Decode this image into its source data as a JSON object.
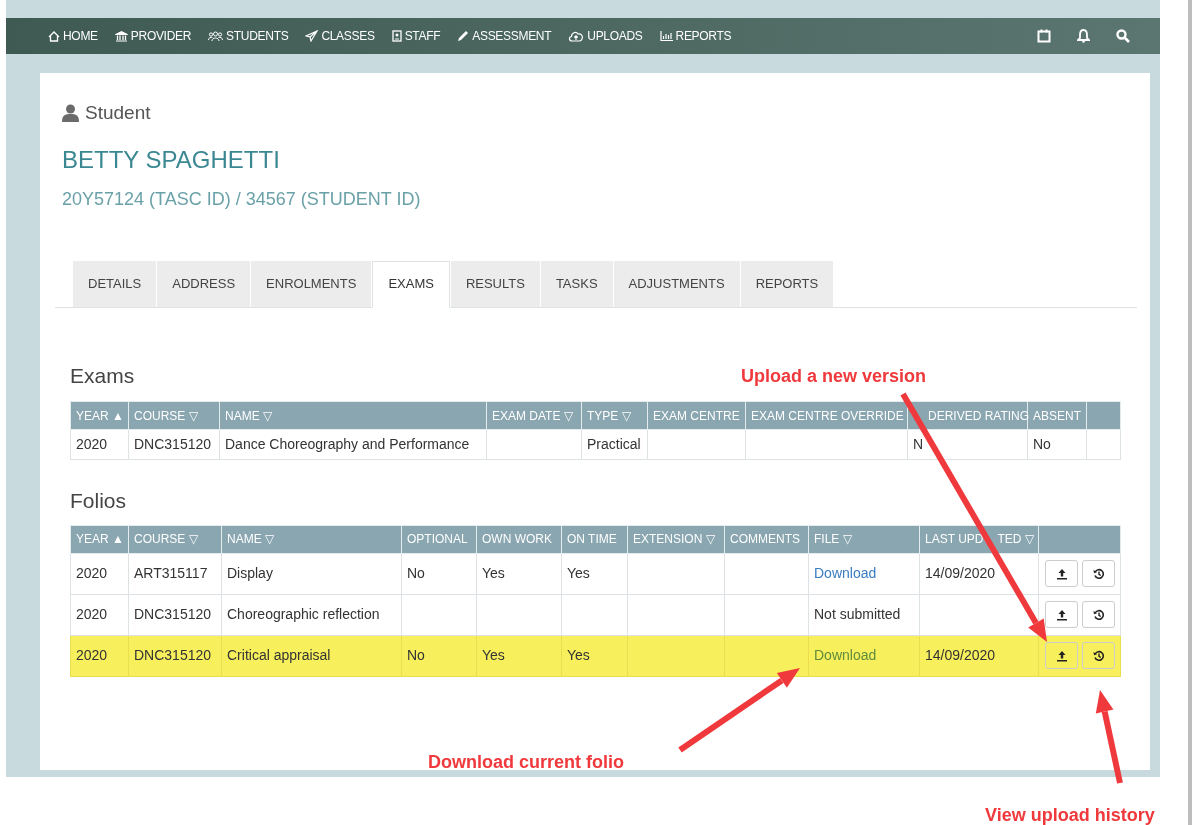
{
  "nav": {
    "items": [
      "HOME",
      "PROVIDER",
      "STUDENTS",
      "CLASSES",
      "STAFF",
      "ASSESSMENT",
      "UPLOADS",
      "REPORTS"
    ]
  },
  "student": {
    "heading": "Student",
    "name": "BETTY SPAGHETTI",
    "ids": "20Y57124 (TASC ID) / 34567 (STUDENT ID)"
  },
  "tabs": [
    {
      "label": "DETAILS",
      "selected": false
    },
    {
      "label": "ADDRESS",
      "selected": false
    },
    {
      "label": "ENROLMENTS",
      "selected": false
    },
    {
      "label": "EXAMS",
      "selected": true
    },
    {
      "label": "RESULTS",
      "selected": false
    },
    {
      "label": "TASKS",
      "selected": false
    },
    {
      "label": "ADJUSTMENTS",
      "selected": false
    },
    {
      "label": "REPORTS",
      "selected": false
    }
  ],
  "exams": {
    "title": "Exams",
    "columns": [
      "YEAR ▲",
      "COURSE ▽",
      "NAME ▽",
      "EXAM DATE ▽",
      "TYPE ▽",
      "EXAM CENTRE",
      "EXAM CENTRE OVERRIDE",
      "DERIVED RATING",
      "ABSENT"
    ],
    "rows": [
      [
        "2020",
        "DNC315120",
        "Dance Choreography and Performance",
        "",
        "Practical",
        "",
        "",
        "N",
        "No"
      ]
    ]
  },
  "folios": {
    "title": "Folios",
    "columns": [
      "YEAR ▲",
      "COURSE ▽",
      "NAME ▽",
      "OPTIONAL",
      "OWN WORK",
      "ON TIME",
      "EXTENSION ▽",
      "COMMENTS",
      "FILE ▽",
      [
        "LAST UPD",
        "TED ▽"
      ]
    ],
    "rows": [
      {
        "selected": false,
        "cells": [
          "2020",
          "ART315117",
          "Display",
          "No",
          "Yes",
          "Yes",
          "",
          "",
          "Download",
          "14/09/2020"
        ],
        "file_link": true
      },
      {
        "selected": false,
        "cells": [
          "2020",
          "DNC315120",
          "Choreographic reflection",
          "",
          "",
          "",
          "",
          "",
          "Not submitted",
          ""
        ],
        "file_link": false
      },
      {
        "selected": true,
        "cells": [
          "2020",
          "DNC315120",
          "Critical appraisal",
          "No",
          "Yes",
          "Yes",
          "",
          "",
          "Download",
          "14/09/2020"
        ],
        "file_link": true
      }
    ]
  },
  "annotations": [
    "Upload a new version",
    "Download current folio",
    "View upload history"
  ]
}
